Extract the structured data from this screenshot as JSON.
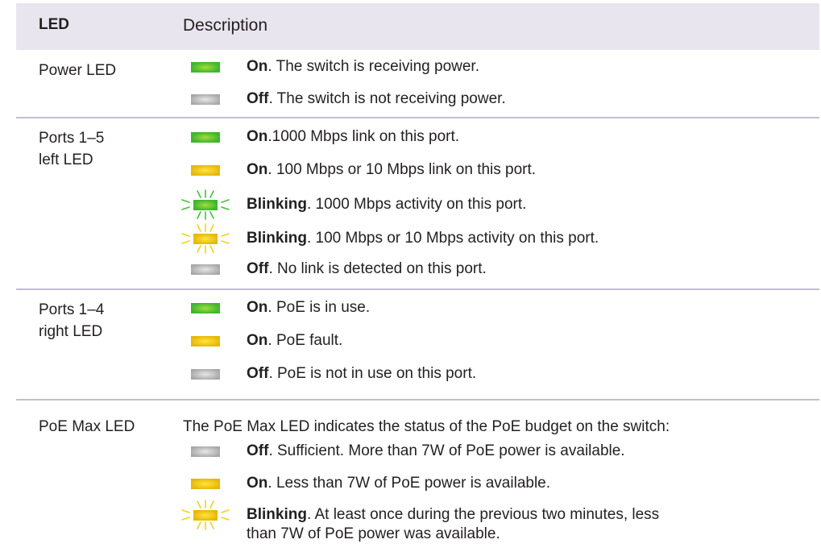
{
  "header": {
    "led_label": "LED",
    "description_label": "Description"
  },
  "sections": [
    {
      "name": "Power LED",
      "rows": [
        {
          "state": "On",
          "text": ". The switch is receiving power.",
          "led": "green",
          "blink": false
        },
        {
          "state": "Off",
          "text": ". The switch is not receiving power.",
          "led": "gray",
          "blink": false
        }
      ]
    },
    {
      "name": "Ports 1–5\nleft LED",
      "rows": [
        {
          "state": "On",
          "text": ".1000 Mbps link on this port.",
          "led": "green",
          "blink": false
        },
        {
          "state": "On",
          "text": ". 100 Mbps or 10 Mbps link on this port.",
          "led": "amber",
          "blink": false
        },
        {
          "state": "Blinking",
          "text": ". 1000 Mbps activity on this port.",
          "led": "green",
          "blink": true
        },
        {
          "state": "Blinking",
          "text": ". 100 Mbps or 10 Mbps activity on this port.",
          "led": "amber",
          "blink": true
        },
        {
          "state": "Off",
          "text": ". No link is detected on this port.",
          "led": "gray",
          "blink": false
        }
      ]
    },
    {
      "name": "Ports 1–4\nright LED",
      "rows": [
        {
          "state": "On",
          "text": ". PoE is in use.",
          "led": "green",
          "blink": false
        },
        {
          "state": "On",
          "text": ". PoE fault.",
          "led": "amber",
          "blink": false
        },
        {
          "state": "Off",
          "text": ". PoE is not in use on this port.",
          "led": "gray",
          "blink": false
        }
      ]
    },
    {
      "name": "PoE Max LED",
      "intro": "The PoE Max LED indicates the status of the PoE budget on the switch:",
      "rows": [
        {
          "state": "Off",
          "text": ". Sufficient. More than 7W of PoE power is available.",
          "led": "gray",
          "blink": false
        },
        {
          "state": "On",
          "text": ". Less than 7W of PoE power is available.",
          "led": "amber",
          "blink": false
        },
        {
          "state": "Blinking",
          "text": ". At least once during the previous two minutes, less than 7W of PoE power was available.",
          "led": "amber",
          "blink": true
        }
      ]
    }
  ],
  "colors": {
    "header_bg": "#e9e5ee",
    "separator": "#c5bdd3",
    "led_green": "#3fb62f",
    "led_amber": "#e7b60a",
    "led_gray": "#a6a6a6",
    "ray_green": "#46c03a",
    "ray_amber": "#f2d21c"
  }
}
